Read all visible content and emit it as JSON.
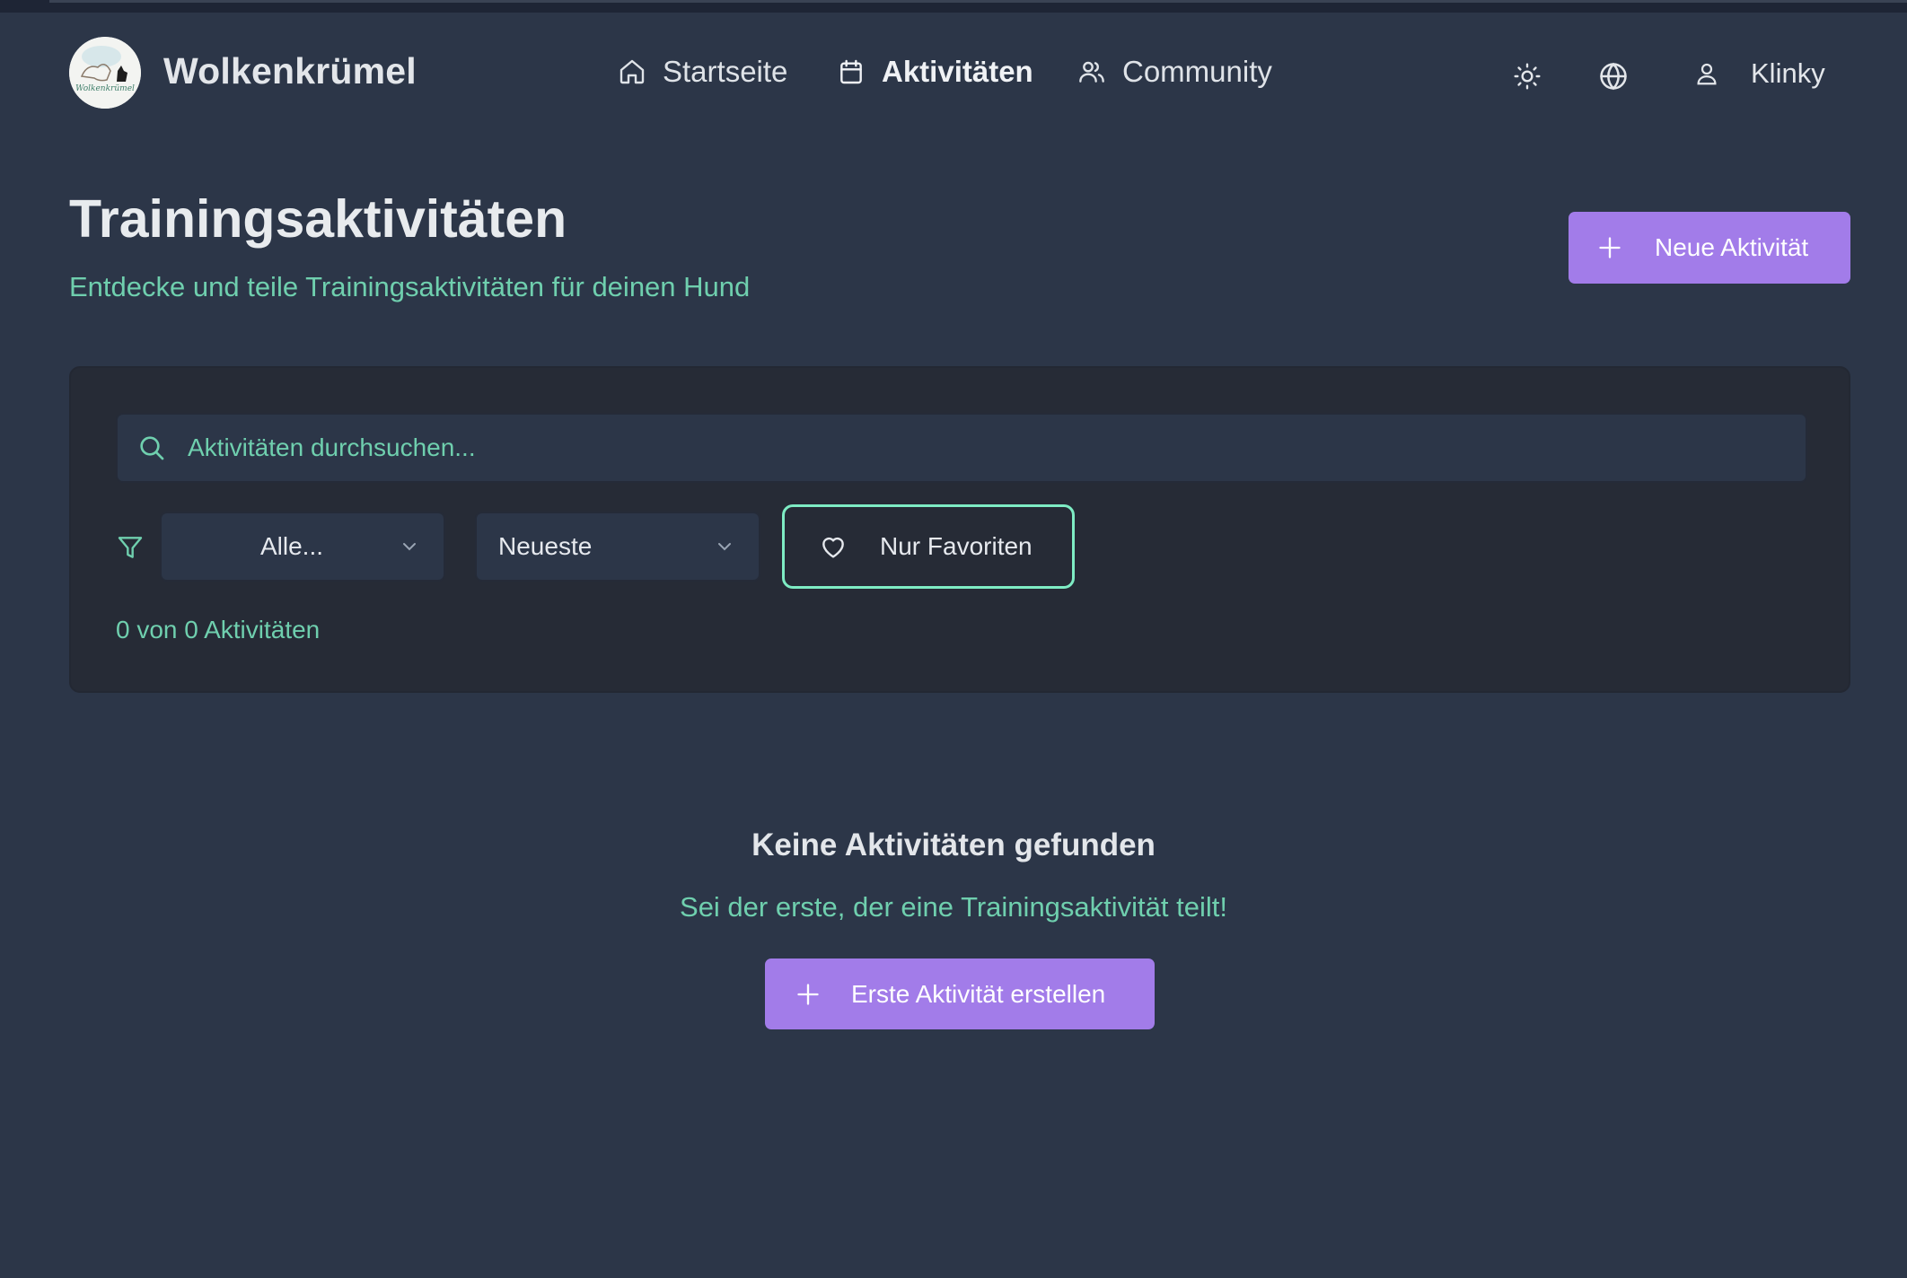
{
  "app": {
    "brand": "Wolkenkrümel",
    "logo_text": "Wolkenkrümel"
  },
  "nav": {
    "items": [
      {
        "label": "Startseite",
        "icon": "home-icon"
      },
      {
        "label": "Aktivitäten",
        "icon": "calendar-icon",
        "active": true
      },
      {
        "label": "Community",
        "icon": "users-icon"
      }
    ],
    "theme_icon": "sun-icon",
    "language_icon": "globe-icon",
    "user": {
      "name": "Klinky",
      "icon": "user-icon"
    }
  },
  "page": {
    "title": "Trainingsaktivitäten",
    "subtitle": "Entdecke und teile Trainingsaktivitäten für deinen Hund",
    "new_button": "Neue Aktivität"
  },
  "filters": {
    "search_placeholder": "Aktivitäten durchsuchen...",
    "category_selected": "Alle...",
    "sort_selected": "Neueste",
    "favorites_label": "Nur Favoriten",
    "count_text": "0 von 0 Aktivitäten"
  },
  "empty_state": {
    "title": "Keine Aktivitäten gefunden",
    "subtitle": "Sei der erste, der eine Trainingsaktivität teilt!",
    "button": "Erste Aktivität erstellen"
  },
  "colors": {
    "background": "#2c3648",
    "panel": "#262b36",
    "accent_purple": "#a27ce9",
    "accent_mint": "#6fcfae",
    "favorites_border": "#7eecc4"
  }
}
